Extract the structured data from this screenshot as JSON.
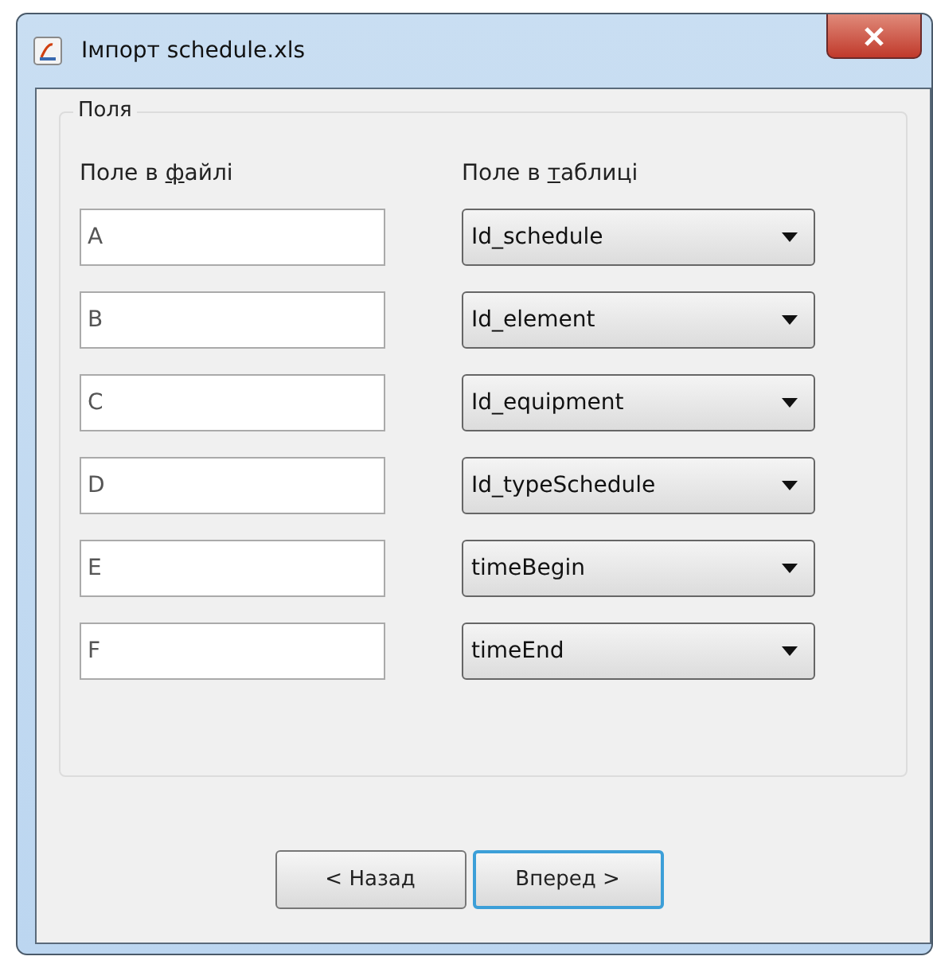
{
  "window": {
    "title": "Імпорт schedule.xls"
  },
  "group": {
    "title": "Поля",
    "headers": [
      {
        "text_before": "Поле в ",
        "mnemonic": "ф",
        "text_after": "айлі"
      },
      {
        "text_before": "Поле в ",
        "mnemonic": "т",
        "text_after": "аблиці"
      }
    ],
    "rows": [
      {
        "file_field": "A",
        "table_field": "Id_schedule"
      },
      {
        "file_field": "B",
        "table_field": "Id_element"
      },
      {
        "file_field": "C",
        "table_field": "Id_equipment"
      },
      {
        "file_field": "D",
        "table_field": "Id_typeSchedule"
      },
      {
        "file_field": "E",
        "table_field": "timeBegin"
      },
      {
        "file_field": "F",
        "table_field": "timeEnd"
      }
    ]
  },
  "buttons": [
    {
      "label": "< Назад",
      "focused": false
    },
    {
      "label": "Вперед >",
      "focused": true
    }
  ]
}
